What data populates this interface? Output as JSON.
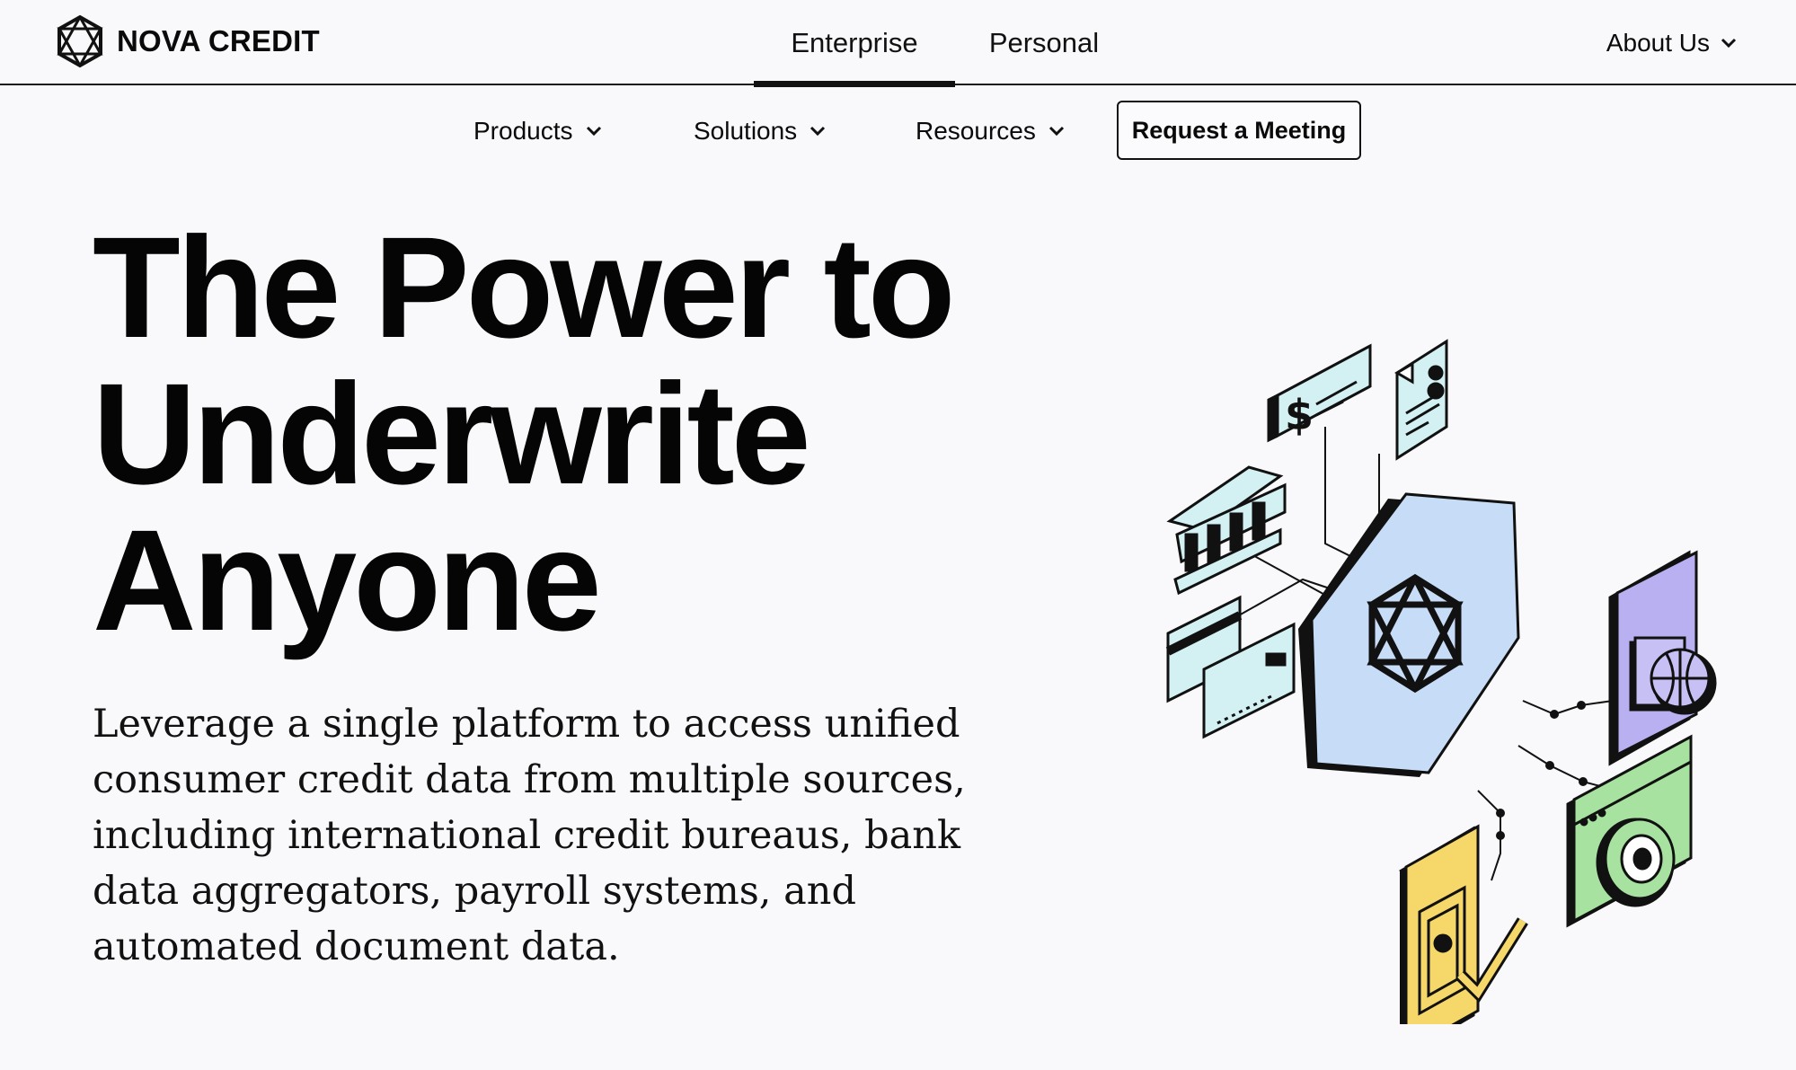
{
  "header": {
    "brand": "NOVA CREDIT",
    "tabs": [
      {
        "label": "Enterprise",
        "active": true
      },
      {
        "label": "Personal",
        "active": false
      }
    ],
    "about_label": "About Us"
  },
  "subnav": {
    "products": "Products",
    "solutions": "Solutions",
    "resources": "Resources",
    "cta": "Request a Meeting"
  },
  "hero": {
    "title_line1": "The Power to",
    "title_line2": "Underwrite",
    "title_line3": "Anyone",
    "body": "Leverage a single platform to access unified consumer credit data from multiple sources, including international credit bureaus, bank data aggregators, payroll systems, and automated document data."
  },
  "colors": {
    "background": "#f9f9fb",
    "text": "#0a0a0a",
    "hub_blue": "#c7dcf6",
    "card_cyan": "#d3f1f3",
    "phone_purple": "#b8b0f0",
    "browser_green": "#a8e2a0",
    "id_yellow": "#f6d86a"
  },
  "icons": [
    "logo-icon",
    "chevron-down-icon",
    "bank-icon",
    "check-icon",
    "document-icon",
    "credit-card-icon",
    "hub-icon",
    "phone-globe-icon",
    "browser-target-icon",
    "id-verify-icon"
  ]
}
